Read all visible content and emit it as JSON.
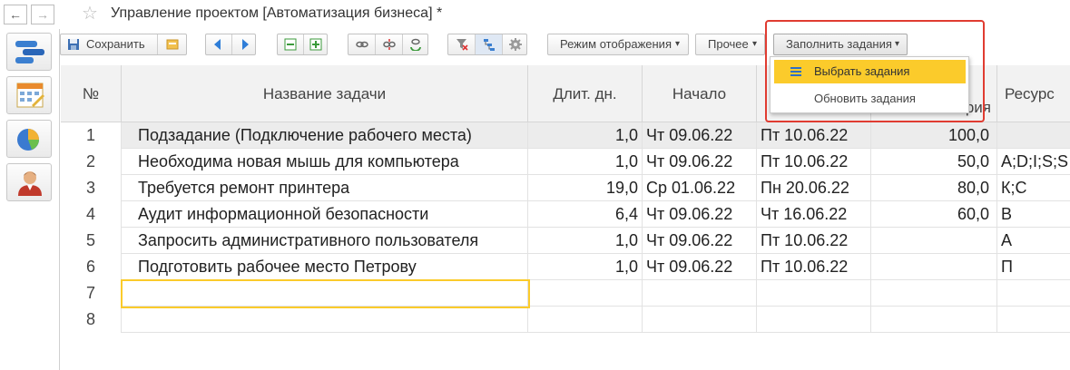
{
  "window": {
    "title": "Управление проектом [Автоматизация бизнеса] *",
    "back_icon": "←",
    "forward_icon": "→",
    "star_icon": "☆"
  },
  "toolbar": {
    "save_label": "Сохранить",
    "display_mode_label": "Режим отображения",
    "other_label": "Прочее",
    "fill_tasks_label": "Заполнить задания",
    "dropdown_arrow": "▾"
  },
  "dropdown": {
    "items": [
      {
        "label": "Выбрать задания",
        "selected": true
      },
      {
        "label": "Обновить задания",
        "selected": false
      }
    ]
  },
  "table": {
    "headers": [
      "№",
      "Название задачи",
      "Длит. дн.",
      "Начало",
      "",
      "рия",
      "Ресурс"
    ],
    "rows": [
      {
        "n": "1",
        "name": "Подзадание (Подключение рабочего места)",
        "dur": "1,0",
        "start": "Чт 09.06.22",
        "end": "Пт 10.06.22",
        "pct": "100,0",
        "res": ""
      },
      {
        "n": "2",
        "name": "Необходима новая мышь для компьютера",
        "dur": "1,0",
        "start": "Чт 09.06.22",
        "end": "Пт 10.06.22",
        "pct": "50,0",
        "res": "A;D;I;S;S"
      },
      {
        "n": "3",
        "name": "Требуется ремонт принтера",
        "dur": "19,0",
        "start": "Ср 01.06.22",
        "end": "Пн 20.06.22",
        "pct": "80,0",
        "res": "К;С"
      },
      {
        "n": "4",
        "name": "Аудит информационной безопасности",
        "dur": "6,4",
        "start": "Чт 09.06.22",
        "end": "Чт 16.06.22",
        "pct": "60,0",
        "res": "В"
      },
      {
        "n": "5",
        "name": "Запросить административного пользователя",
        "dur": "1,0",
        "start": "Чт 09.06.22",
        "end": "Пт 10.06.22",
        "pct": "",
        "res": "А"
      },
      {
        "n": "6",
        "name": "Подготовить рабочее место Петрову",
        "dur": "1,0",
        "start": "Чт 09.06.22",
        "end": "Пт 10.06.22",
        "pct": "",
        "res": "П"
      },
      {
        "n": "7",
        "name": "",
        "dur": "",
        "start": "",
        "end": "",
        "pct": "",
        "res": ""
      },
      {
        "n": "8",
        "name": "",
        "dur": "",
        "start": "",
        "end": "",
        "pct": "",
        "res": ""
      }
    ]
  },
  "colors": {
    "highlight": "#fbcb2b",
    "red_outline": "#e03c31",
    "header_bg": "#f2f2f2",
    "selected_row_bg": "#ececec"
  }
}
